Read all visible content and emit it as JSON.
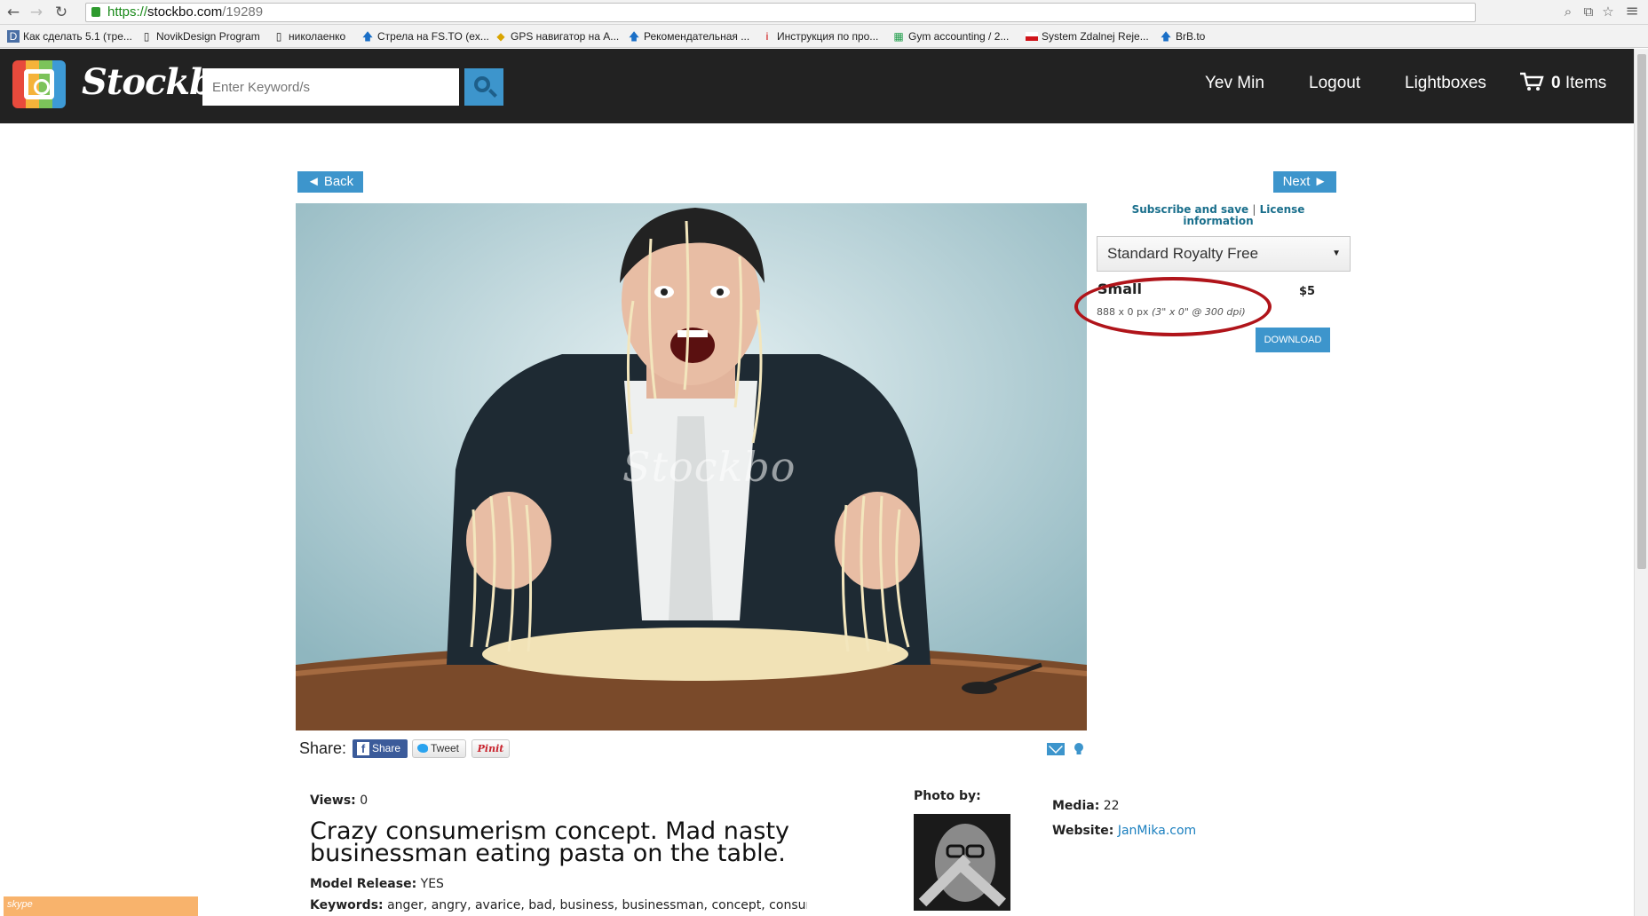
{
  "browser": {
    "url_scheme": "https://",
    "url_host": "stockbo.com",
    "url_path": "/19289",
    "bookmarks": [
      {
        "label": "Как сделать 5.1 (тре...",
        "icon": "page-icon"
      },
      {
        "label": "NovikDesign Program",
        "icon": "page-icon"
      },
      {
        "label": "николаенко",
        "icon": "page-icon"
      },
      {
        "label": "Стрела на FS.TO (ex...",
        "icon": "arrow-up-icon"
      },
      {
        "label": "GPS навигатор на A...",
        "icon": "gps-icon"
      },
      {
        "label": "Рекомендательная ...",
        "icon": "arrow-up-icon"
      },
      {
        "label": "Инструкция по про...",
        "icon": "info-icon"
      },
      {
        "label": "Gym accounting / 2...",
        "icon": "sheet-icon"
      },
      {
        "label": "System Zdalnej Reje...",
        "icon": "flag-icon"
      },
      {
        "label": "BrB.to",
        "icon": "arrow-up-icon"
      }
    ]
  },
  "header": {
    "logo_text": "Stockbo",
    "search_placeholder": "Enter Keyword/s",
    "user_name": "Yev Min",
    "logout": "Logout",
    "lightboxes": "Lightboxes",
    "cart_count": "0",
    "cart_label": "Items"
  },
  "nav": {
    "back": "◄ Back",
    "next": "Next ►"
  },
  "photo": {
    "watermark": "Stockbo"
  },
  "license": {
    "subscribe_link": "Subscribe and save",
    "separator": "|",
    "license_link": "License information",
    "selected_license": "Standard Royalty Free",
    "size_name": "Small",
    "dims": "888 x 0 px",
    "dims_detail": "(3\" x 0\" @ 300 dpi)",
    "price": "$5",
    "download": "DOWNLOAD"
  },
  "share": {
    "label": "Share:",
    "facebook": "Share",
    "twitter": "Tweet",
    "pinterest": "Pinit"
  },
  "details": {
    "views_label": "Views:",
    "views_value": "0",
    "title": "Crazy consumerism concept. Mad nasty businessman eating pasta on the table.",
    "release_label": "Model Release:",
    "release_value": "YES",
    "keywords_label": "Keywords:",
    "keywords_value": "anger, angry, avarice, bad, business, businessman, concept, consumer,",
    "photo_by_label": "Photo by:",
    "media_label": "Media:",
    "media_value": "22",
    "website_label": "Website:",
    "website_value": "JanMika.com"
  },
  "skype": {
    "label": "skype"
  },
  "colors": {
    "accent": "#3d95cc",
    "header_bg": "#222222",
    "annotation": "#b0141a"
  }
}
